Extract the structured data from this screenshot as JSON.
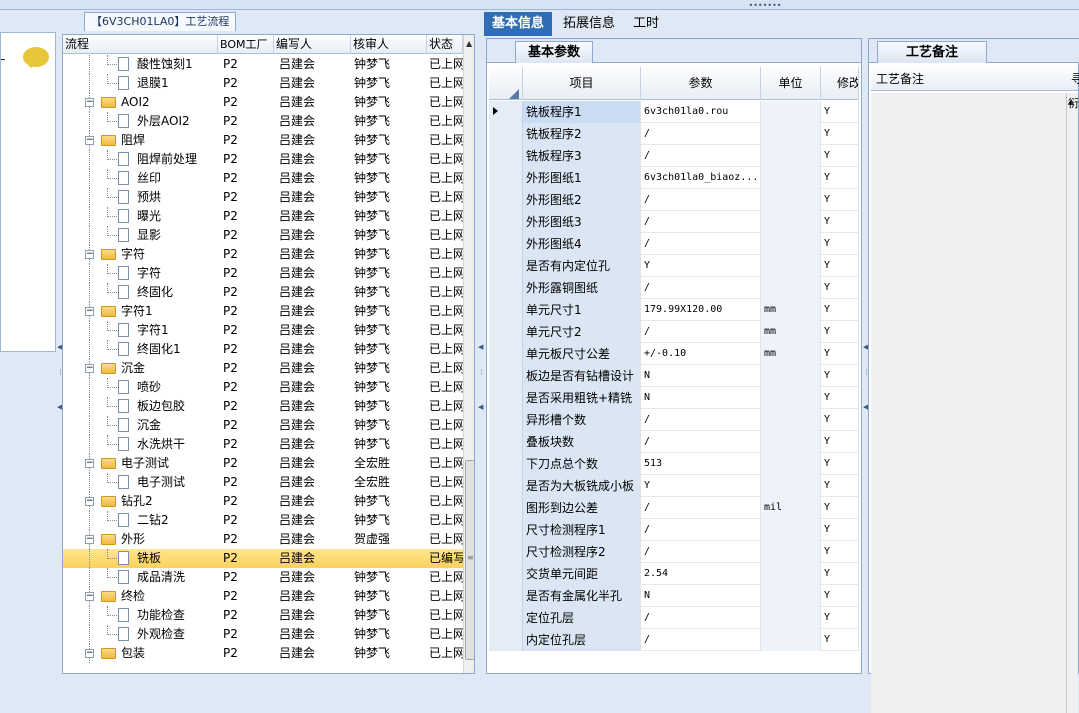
{
  "window": {
    "top_grip": "•••••••"
  },
  "tree": {
    "title": "【6V3CH01LA0】工艺流程",
    "columns": [
      "流程",
      "BOM工厂",
      "编写人",
      "核审人",
      "状态"
    ],
    "rows": [
      {
        "level": 2,
        "type": "step",
        "name": "酸性蚀刻1",
        "bom": "P2",
        "writer": "吕建会",
        "reviewer": "钟梦飞",
        "status": "已上网"
      },
      {
        "level": 2,
        "type": "step",
        "name": "退膜1",
        "bom": "P2",
        "writer": "吕建会",
        "reviewer": "钟梦飞",
        "status": "已上网"
      },
      {
        "level": 1,
        "type": "folder",
        "name": "AOI2",
        "bom": "P2",
        "writer": "吕建会",
        "reviewer": "钟梦飞",
        "status": "已上网"
      },
      {
        "level": 2,
        "type": "step",
        "name": "外层AOI2",
        "bom": "P2",
        "writer": "吕建会",
        "reviewer": "钟梦飞",
        "status": "已上网"
      },
      {
        "level": 1,
        "type": "folder",
        "name": "阻焊",
        "bom": "P2",
        "writer": "吕建会",
        "reviewer": "钟梦飞",
        "status": "已上网"
      },
      {
        "level": 2,
        "type": "step",
        "name": "阻焊前处理",
        "bom": "P2",
        "writer": "吕建会",
        "reviewer": "钟梦飞",
        "status": "已上网"
      },
      {
        "level": 2,
        "type": "step",
        "name": "丝印",
        "bom": "P2",
        "writer": "吕建会",
        "reviewer": "钟梦飞",
        "status": "已上网"
      },
      {
        "level": 2,
        "type": "step",
        "name": "预烘",
        "bom": "P2",
        "writer": "吕建会",
        "reviewer": "钟梦飞",
        "status": "已上网"
      },
      {
        "level": 2,
        "type": "step",
        "name": "曝光",
        "bom": "P2",
        "writer": "吕建会",
        "reviewer": "钟梦飞",
        "status": "已上网"
      },
      {
        "level": 2,
        "type": "step",
        "name": "显影",
        "bom": "P2",
        "writer": "吕建会",
        "reviewer": "钟梦飞",
        "status": "已上网"
      },
      {
        "level": 1,
        "type": "folder",
        "name": "字符",
        "bom": "P2",
        "writer": "吕建会",
        "reviewer": "钟梦飞",
        "status": "已上网"
      },
      {
        "level": 2,
        "type": "step",
        "name": "字符",
        "bom": "P2",
        "writer": "吕建会",
        "reviewer": "钟梦飞",
        "status": "已上网"
      },
      {
        "level": 2,
        "type": "step",
        "name": "终固化",
        "bom": "P2",
        "writer": "吕建会",
        "reviewer": "钟梦飞",
        "status": "已上网"
      },
      {
        "level": 1,
        "type": "folder",
        "name": "字符1",
        "bom": "P2",
        "writer": "吕建会",
        "reviewer": "钟梦飞",
        "status": "已上网"
      },
      {
        "level": 2,
        "type": "step",
        "name": "字符1",
        "bom": "P2",
        "writer": "吕建会",
        "reviewer": "钟梦飞",
        "status": "已上网"
      },
      {
        "level": 2,
        "type": "step",
        "name": "终固化1",
        "bom": "P2",
        "writer": "吕建会",
        "reviewer": "钟梦飞",
        "status": "已上网"
      },
      {
        "level": 1,
        "type": "folder",
        "name": "沉金",
        "bom": "P2",
        "writer": "吕建会",
        "reviewer": "钟梦飞",
        "status": "已上网"
      },
      {
        "level": 2,
        "type": "step",
        "name": "喷砂",
        "bom": "P2",
        "writer": "吕建会",
        "reviewer": "钟梦飞",
        "status": "已上网"
      },
      {
        "level": 2,
        "type": "step",
        "name": "板边包胶",
        "bom": "P2",
        "writer": "吕建会",
        "reviewer": "钟梦飞",
        "status": "已上网"
      },
      {
        "level": 2,
        "type": "step",
        "name": "沉金",
        "bom": "P2",
        "writer": "吕建会",
        "reviewer": "钟梦飞",
        "status": "已上网"
      },
      {
        "level": 2,
        "type": "step",
        "name": "水洗烘干",
        "bom": "P2",
        "writer": "吕建会",
        "reviewer": "钟梦飞",
        "status": "已上网"
      },
      {
        "level": 1,
        "type": "folder",
        "name": "电子测试",
        "bom": "P2",
        "writer": "吕建会",
        "reviewer": "全宏胜",
        "status": "已上网"
      },
      {
        "level": 2,
        "type": "step",
        "name": "电子测试",
        "bom": "P2",
        "writer": "吕建会",
        "reviewer": "全宏胜",
        "status": "已上网"
      },
      {
        "level": 1,
        "type": "folder",
        "name": "钻孔2",
        "bom": "P2",
        "writer": "吕建会",
        "reviewer": "钟梦飞",
        "status": "已上网"
      },
      {
        "level": 2,
        "type": "step",
        "name": "二钻2",
        "bom": "P2",
        "writer": "吕建会",
        "reviewer": "钟梦飞",
        "status": "已上网"
      },
      {
        "level": 1,
        "type": "folder",
        "name": "外形",
        "bom": "P2",
        "writer": "吕建会",
        "reviewer": "贺虚强",
        "status": "已上网"
      },
      {
        "level": 2,
        "type": "step",
        "name": "铣板",
        "bom": "P2",
        "writer": "吕建会",
        "reviewer": "",
        "status": "已编写",
        "selected": true
      },
      {
        "level": 2,
        "type": "step",
        "name": "成品清洗",
        "bom": "P2",
        "writer": "吕建会",
        "reviewer": "钟梦飞",
        "status": "已上网"
      },
      {
        "level": 1,
        "type": "folder",
        "name": "终检",
        "bom": "P2",
        "writer": "吕建会",
        "reviewer": "钟梦飞",
        "status": "已上网"
      },
      {
        "level": 2,
        "type": "step",
        "name": "功能检查",
        "bom": "P2",
        "writer": "吕建会",
        "reviewer": "钟梦飞",
        "status": "已上网"
      },
      {
        "level": 2,
        "type": "step",
        "name": "外观检查",
        "bom": "P2",
        "writer": "吕建会",
        "reviewer": "钟梦飞",
        "status": "已上网"
      },
      {
        "level": 1,
        "type": "folder",
        "name": "包装",
        "bom": "P2",
        "writer": "吕建会",
        "reviewer": "钟梦飞",
        "status": "已上网"
      }
    ]
  },
  "tabs": [
    "基本信息",
    "拓展信息",
    "工时"
  ],
  "active_tab": 0,
  "params": {
    "subtab": "基本参数",
    "columns": [
      "项目",
      "参数",
      "单位",
      "修改"
    ],
    "rows": [
      {
        "item": "铣板程序1",
        "value": "6v3ch01la0.rou",
        "unit": "",
        "flag": "Y"
      },
      {
        "item": "铣板程序2",
        "value": "/",
        "unit": "",
        "flag": "Y"
      },
      {
        "item": "铣板程序3",
        "value": "/",
        "unit": "",
        "flag": "Y"
      },
      {
        "item": "外形图纸1",
        "value": "6v3ch01la0_biaoz...",
        "unit": "",
        "flag": "Y"
      },
      {
        "item": "外形图纸2",
        "value": "/",
        "unit": "",
        "flag": "Y"
      },
      {
        "item": "外形图纸3",
        "value": "/",
        "unit": "",
        "flag": "Y"
      },
      {
        "item": "外形图纸4",
        "value": "/",
        "unit": "",
        "flag": "Y"
      },
      {
        "item": "是否有内定位孔",
        "value": "Y",
        "unit": "",
        "flag": "Y"
      },
      {
        "item": "外形露铜图纸",
        "value": "/",
        "unit": "",
        "flag": "Y"
      },
      {
        "item": "单元尺寸1",
        "value": "179.99X120.00",
        "unit": "mm",
        "flag": "Y"
      },
      {
        "item": "单元尺寸2",
        "value": "/",
        "unit": "mm",
        "flag": "Y"
      },
      {
        "item": "单元板尺寸公差",
        "value": "+/-0.10",
        "unit": "mm",
        "flag": "Y"
      },
      {
        "item": "板边是否有钻槽设计",
        "value": "N",
        "unit": "",
        "flag": "Y"
      },
      {
        "item": "是否采用粗铣+精铣",
        "value": "N",
        "unit": "",
        "flag": "Y"
      },
      {
        "item": "异形槽个数",
        "value": "/",
        "unit": "",
        "flag": "Y"
      },
      {
        "item": "叠板块数",
        "value": "/",
        "unit": "",
        "flag": "Y"
      },
      {
        "item": "下刀点总个数",
        "value": "513",
        "unit": "",
        "flag": "Y"
      },
      {
        "item": "是否为大板铣成小板",
        "value": "Y",
        "unit": "",
        "flag": "Y"
      },
      {
        "item": "图形到边公差",
        "value": "/",
        "unit": "mil",
        "flag": "Y"
      },
      {
        "item": "尺寸检测程序1",
        "value": "/",
        "unit": "",
        "flag": "Y"
      },
      {
        "item": "尺寸检测程序2",
        "value": "/",
        "unit": "",
        "flag": "Y"
      },
      {
        "item": "交货单元间距",
        "value": "2.54",
        "unit": "",
        "flag": "Y"
      },
      {
        "item": "是否有金属化半孔",
        "value": "N",
        "unit": "",
        "flag": "Y"
      },
      {
        "item": "定位孔层",
        "value": "/",
        "unit": "",
        "flag": "Y"
      },
      {
        "item": "内定位孔层",
        "value": "/",
        "unit": "",
        "flag": "Y"
      }
    ]
  },
  "remark": {
    "subtab": "工艺备注",
    "column": "工艺备注",
    "column2": "寻",
    "cell_peek": "衍"
  },
  "colors": {
    "active_tab_bg": "#2f6db5",
    "selected_row": "#fbd25a",
    "frame": "#dfe9f5"
  }
}
